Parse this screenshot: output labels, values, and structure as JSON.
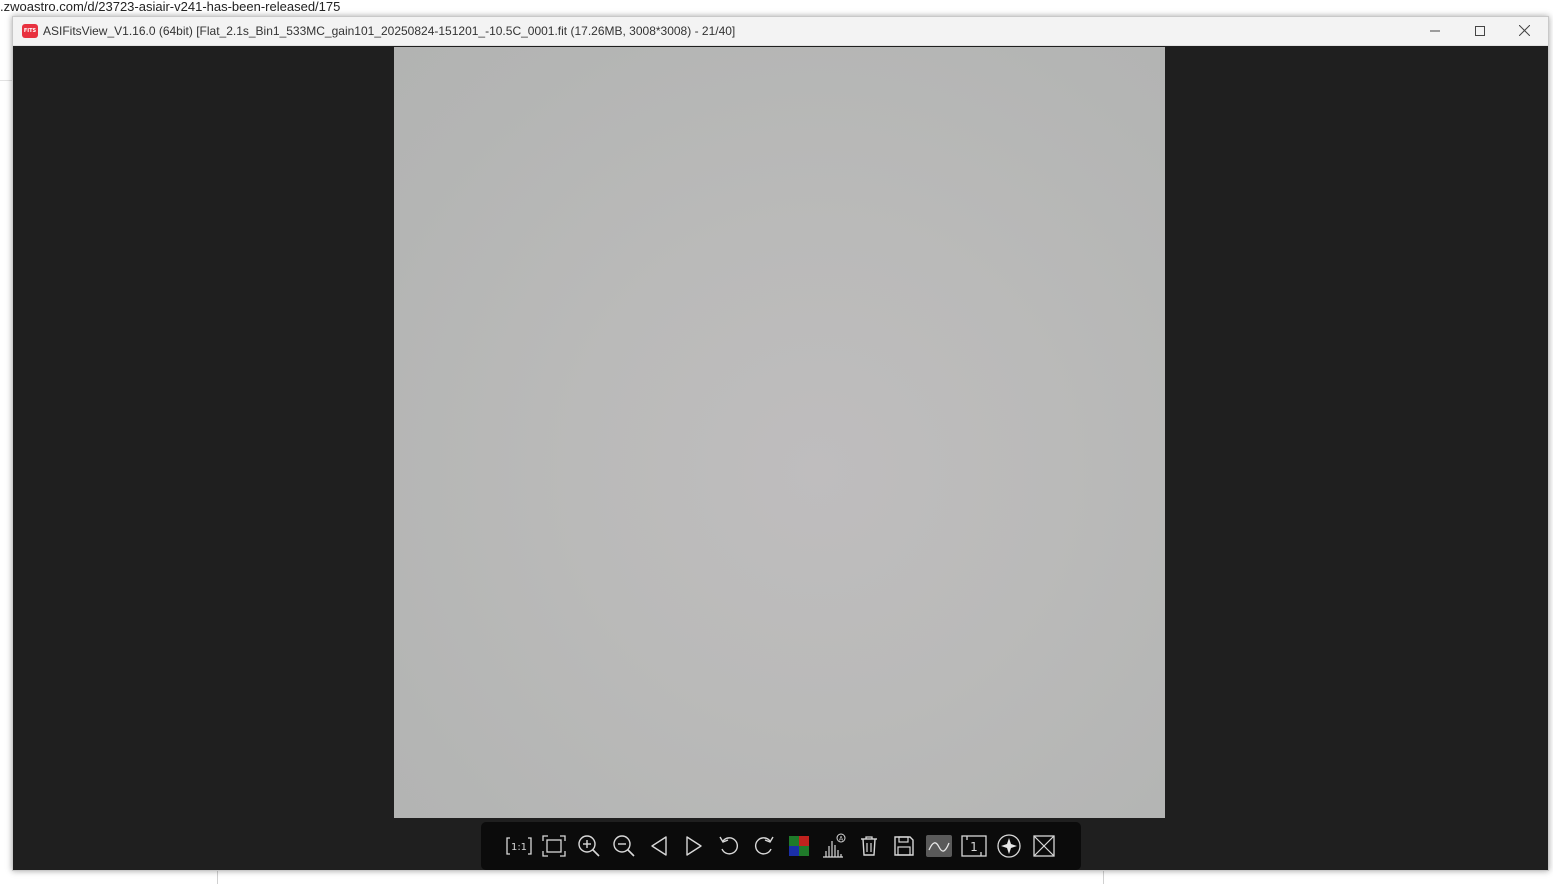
{
  "browser": {
    "url_fragment": ".zwoastro.com/d/23723-asiair-v241-has-been-released/175"
  },
  "window": {
    "app_icon_text": "FITS",
    "title": "ASIFitsView_V1.16.0 (64bit) [Flat_2.1s_Bin1_533MC_gain101_20250824-151201_-10.5C_0001.fit (17.26MB, 3008*3008) - 21/40]",
    "controls": [
      "minimize-icon",
      "maximize-icon",
      "close-icon"
    ]
  },
  "viewer": {
    "image_tone": "#b8b8b7"
  },
  "toolbar": {
    "buttons": [
      {
        "icon": "actual-size-icon",
        "label": "1:1"
      },
      {
        "icon": "fit-to-window-icon"
      },
      {
        "icon": "zoom-in-icon"
      },
      {
        "icon": "zoom-out-icon"
      },
      {
        "icon": "previous-icon"
      },
      {
        "icon": "next-icon"
      },
      {
        "icon": "rotate-left-icon"
      },
      {
        "icon": "rotate-right-icon"
      },
      {
        "icon": "debayer-color-icon"
      },
      {
        "icon": "auto-stretch-histogram-icon"
      },
      {
        "icon": "delete-icon"
      },
      {
        "icon": "save-icon"
      },
      {
        "icon": "image-stretch-icon"
      },
      {
        "icon": "single-frame-icon",
        "label": "1"
      },
      {
        "icon": "star-detect-icon"
      },
      {
        "icon": "crosshair-icon"
      }
    ]
  },
  "colors": {
    "window_bg": "#1f1f1f",
    "titlebar_bg": "#f3f3f3",
    "toolbar_bg": "#0b0b0b",
    "toolbar_icon": "#d8d8d8",
    "app_icon": "#e8313f"
  }
}
